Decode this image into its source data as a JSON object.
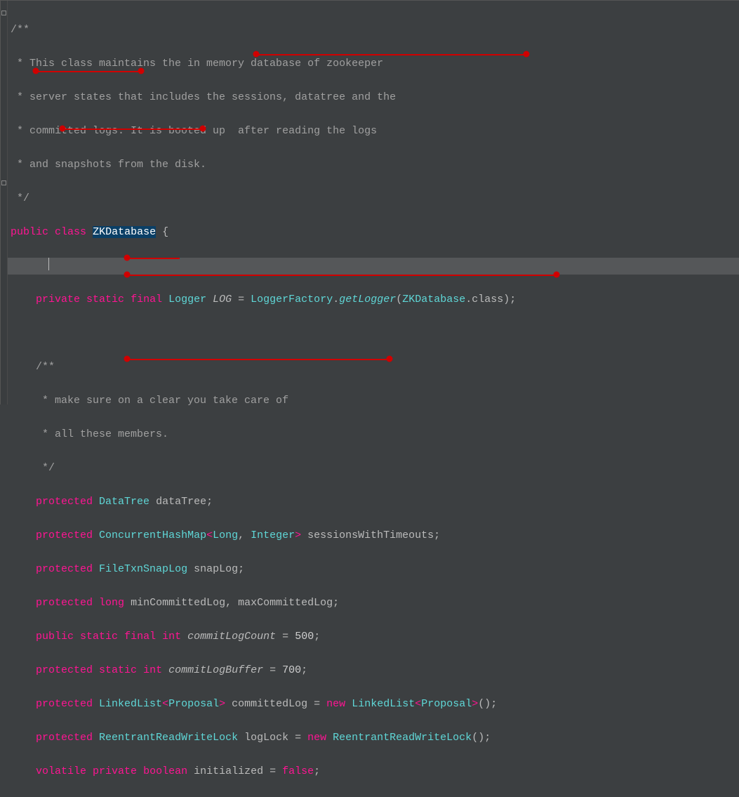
{
  "comment": {
    "l1": "/**",
    "l2": " * This class maintains the in memory database of zookeeper",
    "l3": " * server states that includes the sessions, datatree and the",
    "l4": " * committed logs. It is booted up  after reading the logs",
    "l5": " * and snapshots from the disk.",
    "l6": " */"
  },
  "decl": {
    "public": "public",
    "class": "class",
    "name": "ZKDatabase",
    "brace": " {"
  },
  "log": {
    "t1": "    ",
    "kw_private": "private",
    "kw_static": "static",
    "kw_final": "final",
    "type": "Logger",
    "var": "LOG",
    "eq": " = ",
    "factory": "LoggerFactory",
    "dot": ".",
    "method": "getLogger",
    "lp": "(",
    "arg": "ZKDatabase",
    "cls": ".class",
    "end": ");"
  },
  "comment2": {
    "l1": "    /**",
    "l2": "     * make sure on a clear you take care of",
    "l3": "     * all these members.",
    "l4": "     */"
  },
  "f1": {
    "kw": "protected",
    "type": "DataTree",
    "rest": " dataTree;"
  },
  "f2": {
    "kw": "protected",
    "type": "ConcurrentHashMap",
    "lt": "<",
    "g1": "Long",
    "comma": ", ",
    "g2": "Integer",
    "gt": ">",
    "rest": " sessionsWithTimeouts;"
  },
  "f3": {
    "kw": "protected",
    "type": "FileTxnSnapLog",
    "rest": " snapLog;"
  },
  "f4": {
    "kw": "protected",
    "type": "long",
    "rest": " minCommittedLog, maxCommittedLog;"
  },
  "f5": {
    "kw1": "public",
    "kw2": "static",
    "kw3": "final",
    "type": "int",
    "var": "commitLogCount",
    "eq": " = ",
    "num": "500",
    "end": ";"
  },
  "f6": {
    "kw1": "protected",
    "kw2": "static",
    "type": "int",
    "var": "commitLogBuffer",
    "eq": " = ",
    "num": "700",
    "end": ";"
  },
  "f7": {
    "kw": "protected",
    "type": "LinkedList",
    "lt": "<",
    "g": "Proposal",
    "gt": ">",
    "var": " committedLog",
    "eq": " = ",
    "new": "new",
    "type2": "LinkedList",
    "lt2": "<",
    "g2": "Proposal",
    "gt2": ">",
    "end": "();"
  },
  "f8": {
    "kw": "protected",
    "type": "ReentrantReadWriteLock",
    "var": " logLock",
    "eq": " = ",
    "new": "new",
    "type2": "ReentrantReadWriteLock",
    "end": "();"
  },
  "f9": {
    "kw1": "volatile",
    "kw2": "private",
    "type": "boolean",
    "rest": " initialized = ",
    "val": "false",
    "end": ";"
  }
}
